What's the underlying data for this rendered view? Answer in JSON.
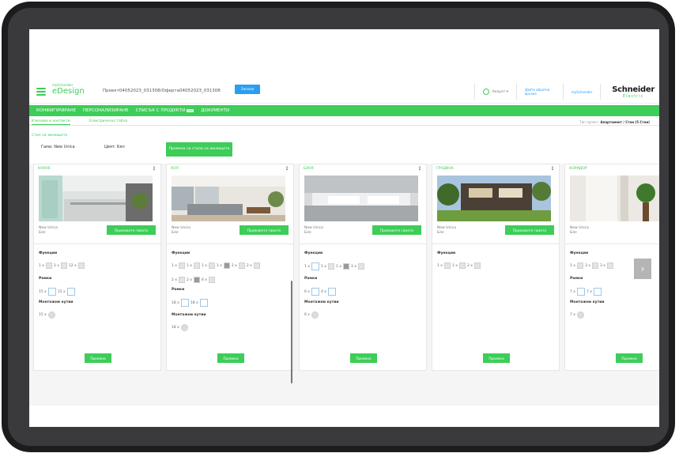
{
  "header": {
    "brand_small": "mySchneider",
    "brand_big": "eDesign",
    "project": "Проект04052023_031308/Оферта04052023_031308",
    "save_label": "Запази",
    "account": "Акаунт ▾",
    "feedback": "Дайте обратна връзка",
    "myschneider": "mySchneider",
    "logo_top": "Schneider",
    "logo_bottom": "Electric"
  },
  "nav": {
    "items": [
      "КОНФИГУРИРАНЕ",
      "ПЕРСОНАЛИЗИРАНЕ",
      "СПИСЪК С ПРОДУКТИ",
      "ДОКУМЕНТИ"
    ],
    "badge": "BOP"
  },
  "subtabs": {
    "items": [
      "Ключове и контакти",
      "Електрическо табло"
    ],
    "project_type_label": "Тип проект:",
    "project_type_value": "Апартамент / Стаи (5 Стаи)"
  },
  "style": {
    "label": "Стил на жилището",
    "range": "Гама: New Unica",
    "color": "Цвят: Бял",
    "change_button": "Промяна на стила на жилището"
  },
  "rooms": [
    {
      "title": "КУХНЯ",
      "range": "New Unica",
      "color": "Бял",
      "apply": "Приложете гамата",
      "functions_label": "Функции",
      "functions": [
        "1 x",
        "2 x",
        "12 x"
      ],
      "frames_label": "Рамки",
      "frames": [
        "15 x",
        "15 x"
      ],
      "boxes_label": "Монтажни кутии",
      "boxes": [
        "15 x"
      ],
      "change": "Промяна"
    },
    {
      "title": "ХОЛ",
      "range": "New Unica",
      "color": "Бял",
      "apply": "Приложете гамата",
      "functions_label": "Функции",
      "functions": [
        "1 x",
        "1 x",
        "1 x",
        "1 x",
        "2 x",
        "2 x"
      ],
      "functions2": [
        "2 x",
        "2 x",
        "6 x"
      ],
      "frames_label": "Рамки",
      "frames": [
        "18 x",
        "18 x"
      ],
      "boxes_label": "Монтажни кутии",
      "boxes": [
        "18 x"
      ],
      "change": "Промяна"
    },
    {
      "title": "БАНЯ",
      "range": "New Unica",
      "color": "Бял",
      "apply": "Приложете гамата",
      "functions_label": "Функции",
      "functions": [
        "1 x",
        "1 x",
        "1 x",
        "3 x"
      ],
      "frames_label": "Рамки",
      "frames": [
        "6 x",
        "4 x"
      ],
      "boxes_label": "Монтажни кутии",
      "boxes": [
        "6 x"
      ],
      "change": "Промяна"
    },
    {
      "title": "ГРАДИНА",
      "range": "New Unica",
      "color": "Бял",
      "apply": "Приложете гамата",
      "functions_label": "Функции",
      "functions": [
        "1 x",
        "1 x",
        "2 x"
      ],
      "change": "Промяна"
    },
    {
      "title": "КОРИДОР",
      "range": "New Unica",
      "color": "Бял",
      "apply": "Приложете гамата",
      "functions_label": "Функции",
      "functions": [
        "1 x",
        "3 x",
        "3 x"
      ],
      "frames_label": "Рамки",
      "frames": [
        "7 x",
        "7 x"
      ],
      "boxes_label": "Монтажни кутии",
      "boxes": [
        "7 x"
      ],
      "change": "Промяна"
    }
  ],
  "colors": {
    "accent": "#3dcd58",
    "link": "#2b9ef0"
  }
}
